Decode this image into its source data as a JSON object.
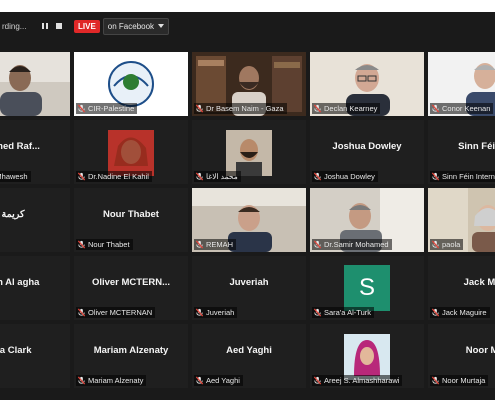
{
  "toolbar": {
    "recording_label": "rding...",
    "pause_icon": "pause-icon",
    "stop_icon": "stop-icon",
    "live_label": "LIVE",
    "stream_label": "on Facebook",
    "dropdown_icon": "caret-down-icon"
  },
  "participants": [
    {
      "name": "Waleed",
      "display": "",
      "video": "person-indoor",
      "muted": true
    },
    {
      "name": "CIR-Palestine",
      "display": "",
      "video": "logo",
      "muted": true
    },
    {
      "name": "Dr Basem Naim - Gaza",
      "display": "",
      "video": "person-bookshelf",
      "muted": true,
      "active": true
    },
    {
      "name": "Declan Kearney",
      "display": "",
      "video": "person-glasses",
      "muted": true
    },
    {
      "name": "Conor Keenan",
      "display": "",
      "video": "person-light",
      "muted": true
    },
    {
      "name": "d Rafik Mhawesh",
      "display": "mmed Raf...",
      "video": "",
      "muted": true
    },
    {
      "name": "Dr.Nadine El Kahil",
      "display": "",
      "video": "avatar-red",
      "muted": true
    },
    {
      "name": "محمد الاغا",
      "display": "",
      "video": "avatar-beard",
      "muted": true
    },
    {
      "name": "Joshua Dowley",
      "display": "Joshua Dowley",
      "video": "",
      "muted": true
    },
    {
      "name": "Sinn Féin Interna",
      "display": "Sinn Féin In",
      "video": "",
      "muted": true
    },
    {
      "name": "",
      "display": "كريمة",
      "video": "",
      "muted": true
    },
    {
      "name": "Nour Thabet",
      "display": "Nour Thabet",
      "video": "",
      "muted": true
    },
    {
      "name": "REMAH",
      "display": "",
      "video": "person-center",
      "muted": true
    },
    {
      "name": "Dr.Samir Mohamed",
      "display": "",
      "video": "person-window",
      "muted": true
    },
    {
      "name": "paola",
      "display": "",
      "video": "person-elder",
      "muted": true
    },
    {
      "name": "Al agha",
      "display": "san Al agha",
      "video": "",
      "muted": true
    },
    {
      "name": "Oliver MCTERNAN",
      "display": "Oliver  MCTERN...",
      "video": "",
      "muted": true
    },
    {
      "name": "Juveriah",
      "display": "Juveriah",
      "video": "",
      "muted": true
    },
    {
      "name": "Sara'a Al-Turk",
      "display": "",
      "video": "letter-avatar",
      "letter": "S",
      "muted": true
    },
    {
      "name": "Jack Maguire",
      "display": "Jack Mag",
      "video": "",
      "muted": true
    },
    {
      "name": "k",
      "display": "lia Clark",
      "video": "",
      "muted": true
    },
    {
      "name": "Mariam Alzenaty",
      "display": "Mariam Alzenaty",
      "video": "",
      "muted": true
    },
    {
      "name": "Aed Yaghi",
      "display": "Aed Yaghi",
      "video": "",
      "muted": true
    },
    {
      "name": "Areej S. Almashharawi",
      "display": "",
      "video": "avatar-hijab",
      "muted": true
    },
    {
      "name": "Noor Murtaja",
      "display": "Noor Mu",
      "video": "",
      "muted": true
    }
  ],
  "colors": {
    "live": "#e02828",
    "active_speaker": "#c8d96a",
    "mic_muted": "#e0463c",
    "avatar_s": "#1e8f6e"
  }
}
